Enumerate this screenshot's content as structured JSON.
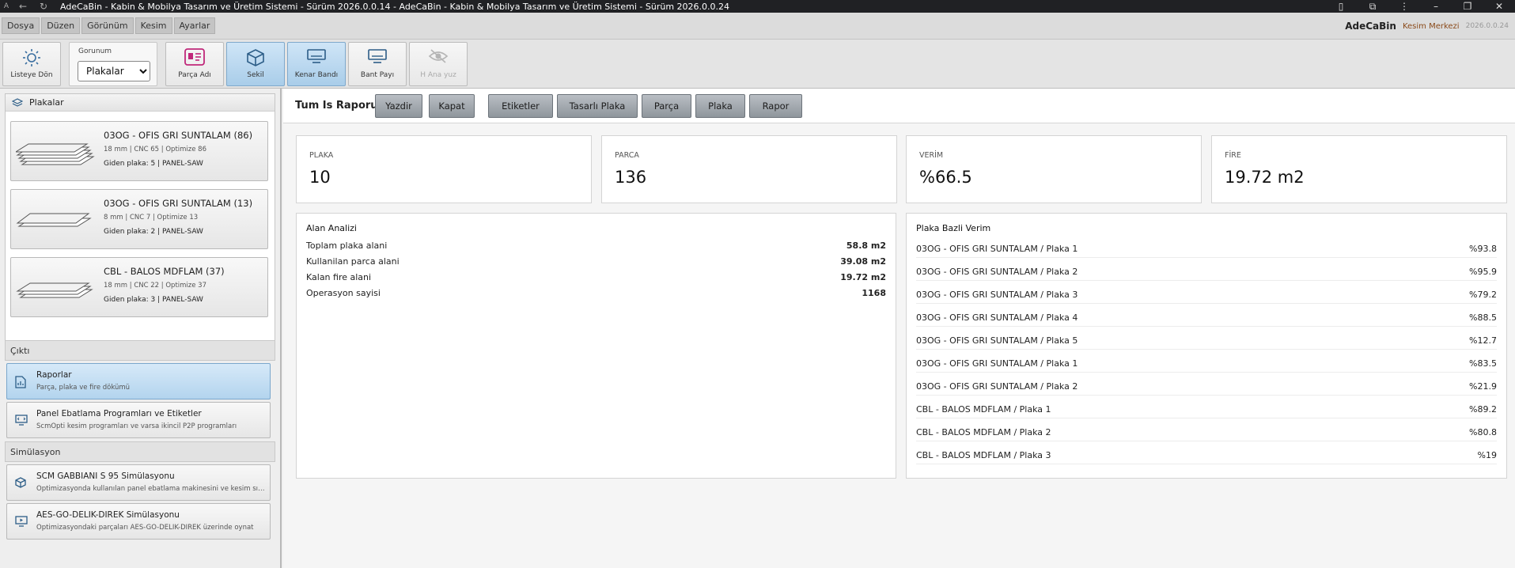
{
  "titlebar": {
    "app_icon": "A",
    "title": "AdeCaBin - Kabin & Mobilya Tasarım ve Üretim Sistemi - Sürüm 2026.0.0.14 - AdeCaBin - Kabin & Mobilya Tasarım ve Üretim Sistemi - Sürüm 2026.0.0.24"
  },
  "menu": {
    "items": [
      "Dosya",
      "Düzen",
      "Görünüm",
      "Kesim",
      "Ayarlar"
    ],
    "brand": "AdeCaBin",
    "center": "Kesim Merkezi",
    "version": "2026.0.0.24"
  },
  "toolbar": {
    "back": "Listeye Dön",
    "view_label": "Gorunum",
    "view_value": "Plakalar",
    "part_name": "Parça Adı",
    "shape": "Sekil",
    "edge_band": "Kenar Bandı",
    "band_allowance": "Bant Payı",
    "main_face": "H Ana yuz"
  },
  "left": {
    "sheets_header": "Plakalar",
    "sheets": [
      {
        "name": "03OG - OFIS GRI SUNTALAM (86)",
        "spec": "18 mm | CNC 65 | Optimize 86",
        "out": "Giden plaka: 5 | PANEL-SAW"
      },
      {
        "name": "03OG - OFIS GRI SUNTALAM (13)",
        "spec": "8 mm | CNC 7 | Optimize 13",
        "out": "Giden plaka: 2 | PANEL-SAW"
      },
      {
        "name": "CBL - BALOS MDFLAM (37)",
        "spec": "18 mm | CNC 22 | Optimize 37",
        "out": "Giden plaka: 3 | PANEL-SAW"
      }
    ],
    "output_header": "Çıktı",
    "reports_title": "Raporlar",
    "reports_sub": "Parça, plaka ve fire dökümü",
    "panel_title": "Panel Ebatlama Programları ve Etiketler",
    "panel_sub": "ScmOpti kesim programları ve varsa ikincil P2P programları",
    "sim_header": "Simülasyon",
    "sim1_title": "SCM GABBIANI S 95 Simülasyonu",
    "sim1_sub": "Optimizasyonda kullanılan panel ebatlama makinesini ve kesim sırasını simüle eder",
    "sim2_title": "AES-GO-DELIK-DIREK Simülasyonu",
    "sim2_sub": "Optimizasyondaki parçaları AES-GO-DELIK-DIREK üzerinde oynat"
  },
  "main": {
    "title": "Tum Is Raporu",
    "buttons": [
      "Yazdir",
      "Kapat",
      "Etiketler",
      "Tasarlı Plaka",
      "Parça",
      "Plaka",
      "Rapor"
    ],
    "stats": [
      {
        "label": "PLAKA",
        "value": "10"
      },
      {
        "label": "PARCA",
        "value": "136"
      },
      {
        "label": "VERİM",
        "value": "%66.5"
      },
      {
        "label": "FİRE",
        "value": "19.72 m2"
      }
    ],
    "area_title": "Alan Analizi",
    "area_rows": [
      {
        "label": "Toplam plaka alani",
        "value": "58.8 m2"
      },
      {
        "label": "Kullanilan parca alani",
        "value": "39.08 m2"
      },
      {
        "label": "Kalan fire alani",
        "value": "19.72 m2"
      },
      {
        "label": "Operasyon sayisi",
        "value": "1168"
      }
    ],
    "yield_title": "Plaka Bazli Verim",
    "yield_rows": [
      {
        "label": "03OG - OFIS GRI SUNTALAM / Plaka 1",
        "value": "%93.8"
      },
      {
        "label": "03OG - OFIS GRI SUNTALAM / Plaka 2",
        "value": "%95.9"
      },
      {
        "label": "03OG - OFIS GRI SUNTALAM / Plaka 3",
        "value": "%79.2"
      },
      {
        "label": "03OG - OFIS GRI SUNTALAM / Plaka 4",
        "value": "%88.5"
      },
      {
        "label": "03OG - OFIS GRI SUNTALAM / Plaka 5",
        "value": "%12.7"
      },
      {
        "label": "03OG - OFIS GRI SUNTALAM / Plaka 1",
        "value": "%83.5"
      },
      {
        "label": "03OG - OFIS GRI SUNTALAM / Plaka 2",
        "value": "%21.9"
      },
      {
        "label": "CBL - BALOS MDFLAM / Plaka 1",
        "value": "%89.2"
      },
      {
        "label": "CBL - BALOS MDFLAM / Plaka 2",
        "value": "%80.8"
      },
      {
        "label": "CBL - BALOS MDFLAM / Plaka 3",
        "value": "%19"
      }
    ]
  }
}
